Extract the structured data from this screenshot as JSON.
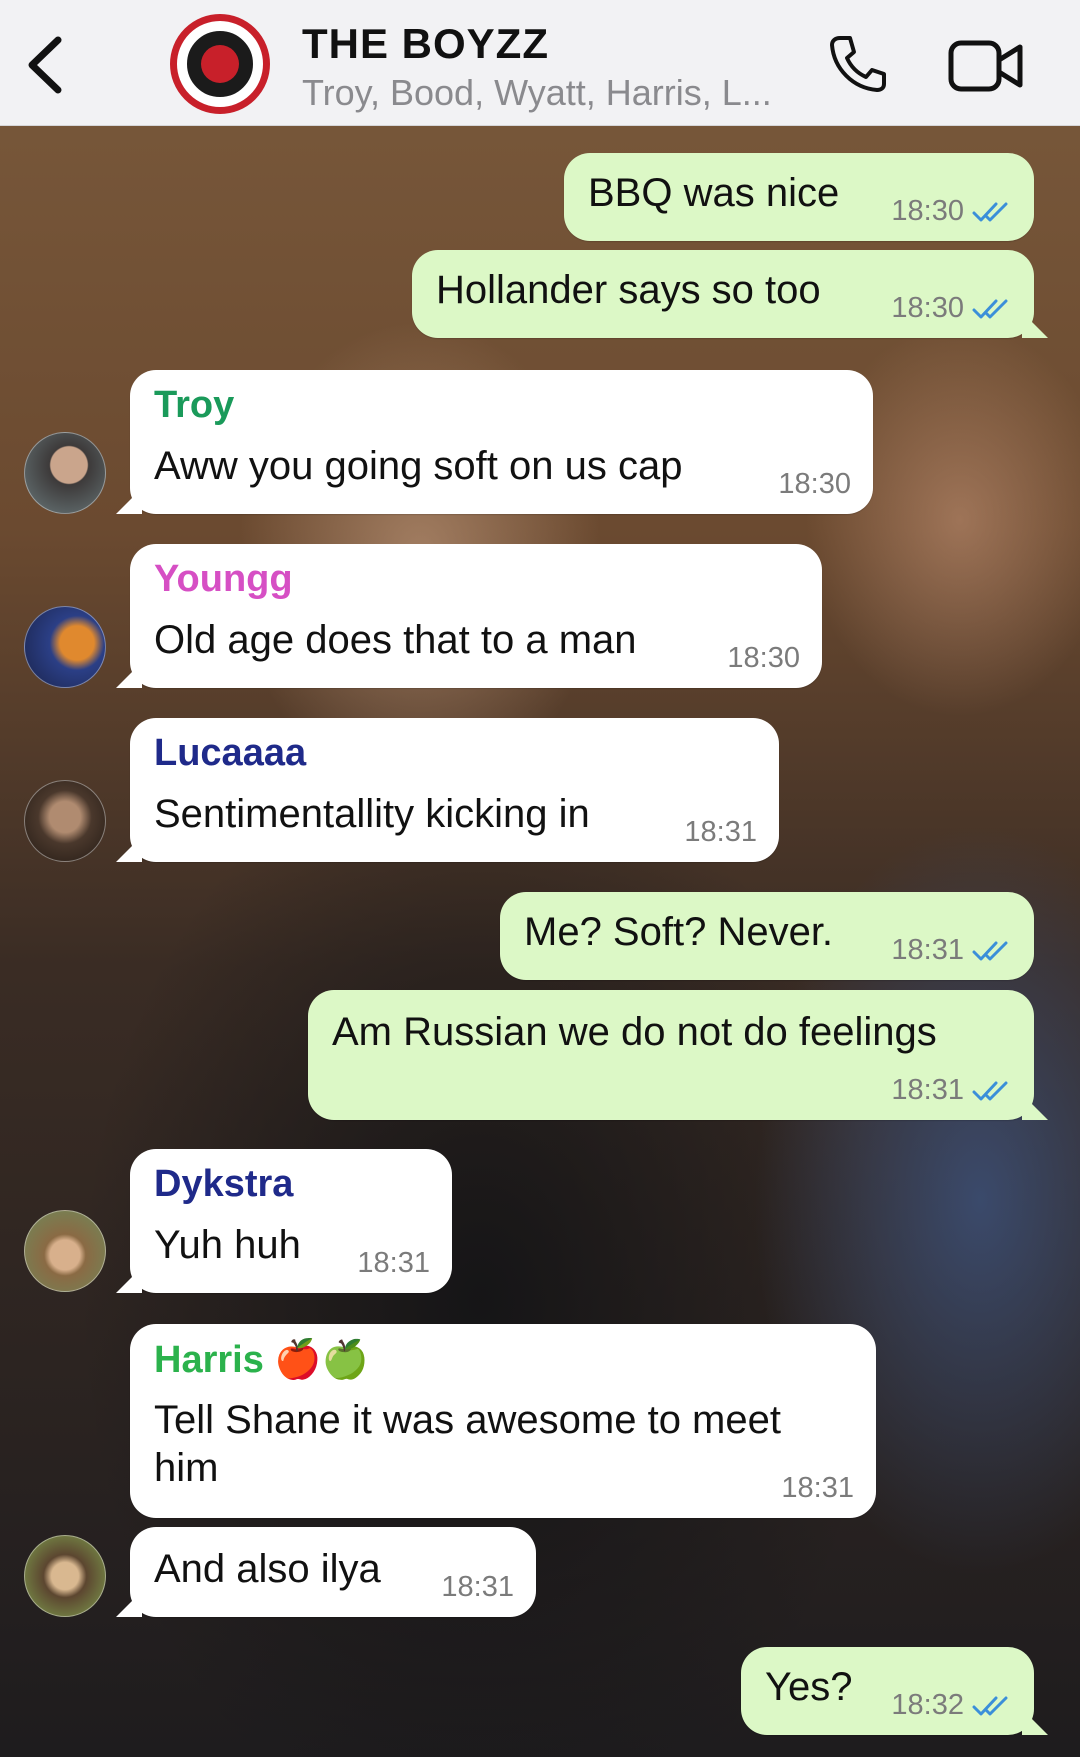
{
  "header": {
    "title": "THE BOYZZ",
    "members": "Troy, Bood, Wyatt, Harris, L..."
  },
  "colors": {
    "outgoing_bubble": "#dcf8c6",
    "incoming_bubble": "#ffffff",
    "read_ticks": "#3b8fd9",
    "troy": "#1a9a5a",
    "youngg": "#d64fc4",
    "lucaaaa": "#1f2a8a",
    "dykstra": "#1f2a8a",
    "harris": "#2bb24c"
  },
  "messages": [
    {
      "text": "BBQ was nice",
      "time": "18:30",
      "status": "read"
    },
    {
      "text": "Hollander says so too",
      "time": "18:30",
      "status": "read"
    },
    {
      "sender": "Troy",
      "text": "Aww you going soft on us cap",
      "time": "18:30"
    },
    {
      "sender": "Youngg",
      "text": "Old age does that to a man",
      "time": "18:30"
    },
    {
      "sender": "Lucaaaa",
      "text": "Sentimentallity kicking in",
      "time": "18:31"
    },
    {
      "text": "Me? Soft? Never.",
      "time": "18:31",
      "status": "read"
    },
    {
      "text": "Am Russian we do not do feelings",
      "time": "18:31",
      "status": "read"
    },
    {
      "sender": "Dykstra",
      "text": "Yuh huh",
      "time": "18:31"
    },
    {
      "sender": "Harris 🍎🍏",
      "text": "Tell Shane it was awesome to meet him",
      "time": "18:31"
    },
    {
      "text": "And also ilya",
      "time": "18:31"
    },
    {
      "text": "Yes?",
      "time": "18:32",
      "status": "read"
    }
  ]
}
